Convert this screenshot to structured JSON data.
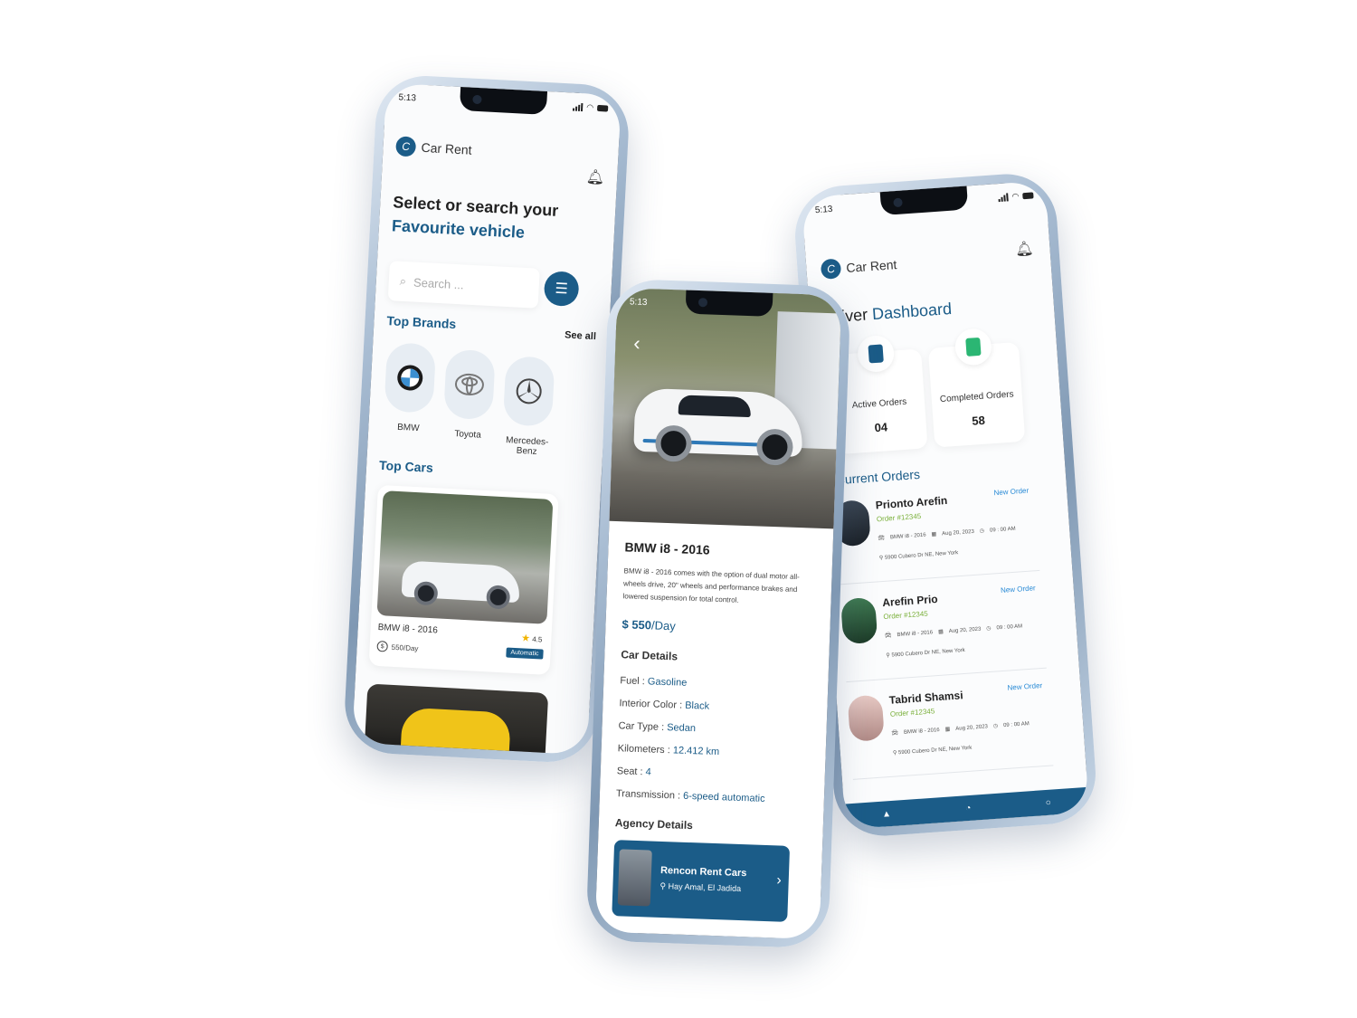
{
  "status": {
    "time": "5:13"
  },
  "app": {
    "name": "Car Rent",
    "logo_letter": "C"
  },
  "home": {
    "headline_1": "Select or search your",
    "headline_2": "Favourite vehicle",
    "search_placeholder": "Search ...",
    "top_brands_title": "Top Brands",
    "see_all": "See all",
    "brands": [
      {
        "name": "BMW",
        "icon": "bmw-logo"
      },
      {
        "name": "Toyota",
        "icon": "toyota-logo"
      },
      {
        "name": "Mercedes-Benz",
        "icon": "mercedes-logo"
      }
    ],
    "top_cars_title": "Top Cars",
    "card": {
      "name": "BMW i8 - 2016",
      "rating": "4.5",
      "price": "550/Day",
      "badge": "Automatic"
    }
  },
  "detail": {
    "title": "BMW i8 - 2016",
    "description": "BMW i8 - 2016 comes with the option of dual motor all-wheels drive, 20\" wheels and performance brakes and lowered suspension for total control.",
    "price_amount": "$ 550",
    "price_unit": "/Day",
    "car_details_title": "Car Details",
    "specs": [
      {
        "label": "Fuel",
        "value": "Gasoline"
      },
      {
        "label": "Interior Color",
        "value": "Black"
      },
      {
        "label": "Car Type",
        "value": "Sedan"
      },
      {
        "label": "Kilometers",
        "value": "12.412 km"
      },
      {
        "label": "Seat",
        "value": "4"
      },
      {
        "label": "Transmission",
        "value": "6-speed automatic"
      }
    ],
    "agency_title": "Agency Details",
    "agency": {
      "name": "Rencon Rent Cars",
      "location": "Hay Amal, El Jadida"
    }
  },
  "dashboard": {
    "title_1": "Driver",
    "title_2": "Dashboard",
    "active_label": "Active Orders",
    "active_value": "04",
    "completed_label": "Completed Orders",
    "completed_value": "58",
    "current_orders_title": "Current Orders",
    "orders": [
      {
        "name": "Prionto Arefin",
        "order": "Order #12345",
        "tag": "New Order",
        "car": "BMW i8 - 2016",
        "date": "Aug 20, 2023",
        "time": "09 : 00 AM",
        "address": "5900 Cubero Dr NE, New York"
      },
      {
        "name": "Arefin Prio",
        "order": "Order #12345",
        "tag": "New Order",
        "car": "BMW i8 - 2016",
        "date": "Aug 20, 2023",
        "time": "09 : 00 AM",
        "address": "5900 Cubero Dr NE, New York"
      },
      {
        "name": "Tabrid Shamsi",
        "order": "Order #12345",
        "tag": "New Order",
        "car": "BMW i8 - 2016",
        "date": "Aug 20, 2023",
        "time": "09 : 00 AM",
        "address": "5900 Cubero Dr NE, New York"
      }
    ]
  },
  "colors": {
    "primary": "#1b5c88",
    "order_id": "#7ab03a",
    "new_order": "#2a8bd6",
    "star": "#f1b400"
  }
}
